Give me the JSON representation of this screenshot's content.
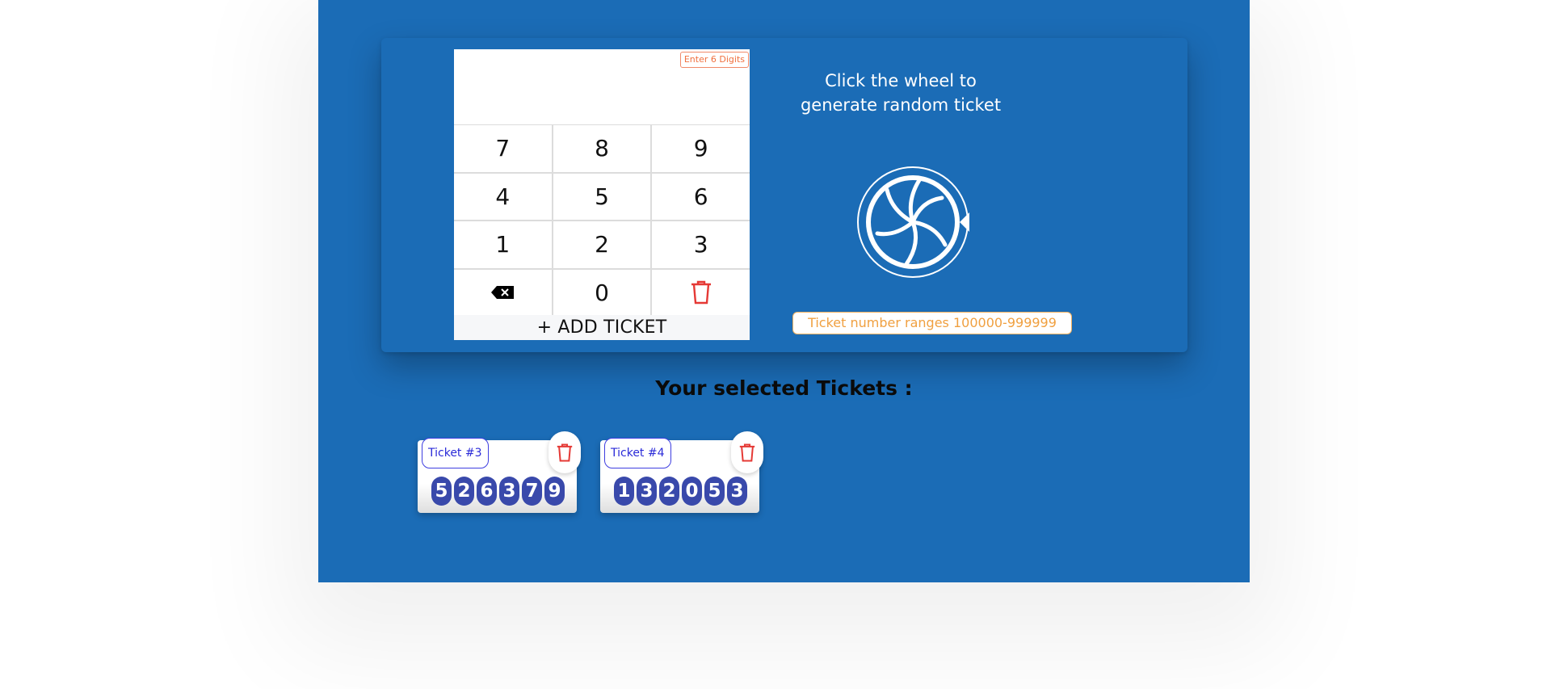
{
  "keypad": {
    "hint": "Enter 6 Digits",
    "display_value": "",
    "keys": [
      {
        "label": "7",
        "name": "key-7"
      },
      {
        "label": "8",
        "name": "key-8"
      },
      {
        "label": "9",
        "name": "key-9"
      },
      {
        "label": "4",
        "name": "key-4"
      },
      {
        "label": "5",
        "name": "key-5"
      },
      {
        "label": "6",
        "name": "key-6"
      },
      {
        "label": "1",
        "name": "key-1"
      },
      {
        "label": "2",
        "name": "key-2"
      },
      {
        "label": "3",
        "name": "key-3"
      },
      {
        "label": "",
        "name": "backspace-key",
        "icon": "backspace-icon"
      },
      {
        "label": "0",
        "name": "key-0"
      },
      {
        "label": "",
        "name": "clear-key",
        "icon": "trash-icon"
      }
    ],
    "add_label": "+ ADD TICKET"
  },
  "wheel": {
    "text": "Click the wheel to generate random ticket",
    "icon": "wheel-icon"
  },
  "range_text": "Ticket number ranges 100000-999999",
  "selected_title": "Your selected Tickets :",
  "tickets": [
    {
      "label": "Ticket #3",
      "digits": [
        "5",
        "2",
        "6",
        "3",
        "7",
        "9"
      ]
    },
    {
      "label": "Ticket #4",
      "digits": [
        "1",
        "3",
        "2",
        "0",
        "5",
        "3"
      ]
    }
  ],
  "colors": {
    "background": "#1b6cb6",
    "digit": "#3949ab",
    "delete": "#e53935",
    "range_text": "#f0a040",
    "hint": "#f0703f"
  }
}
